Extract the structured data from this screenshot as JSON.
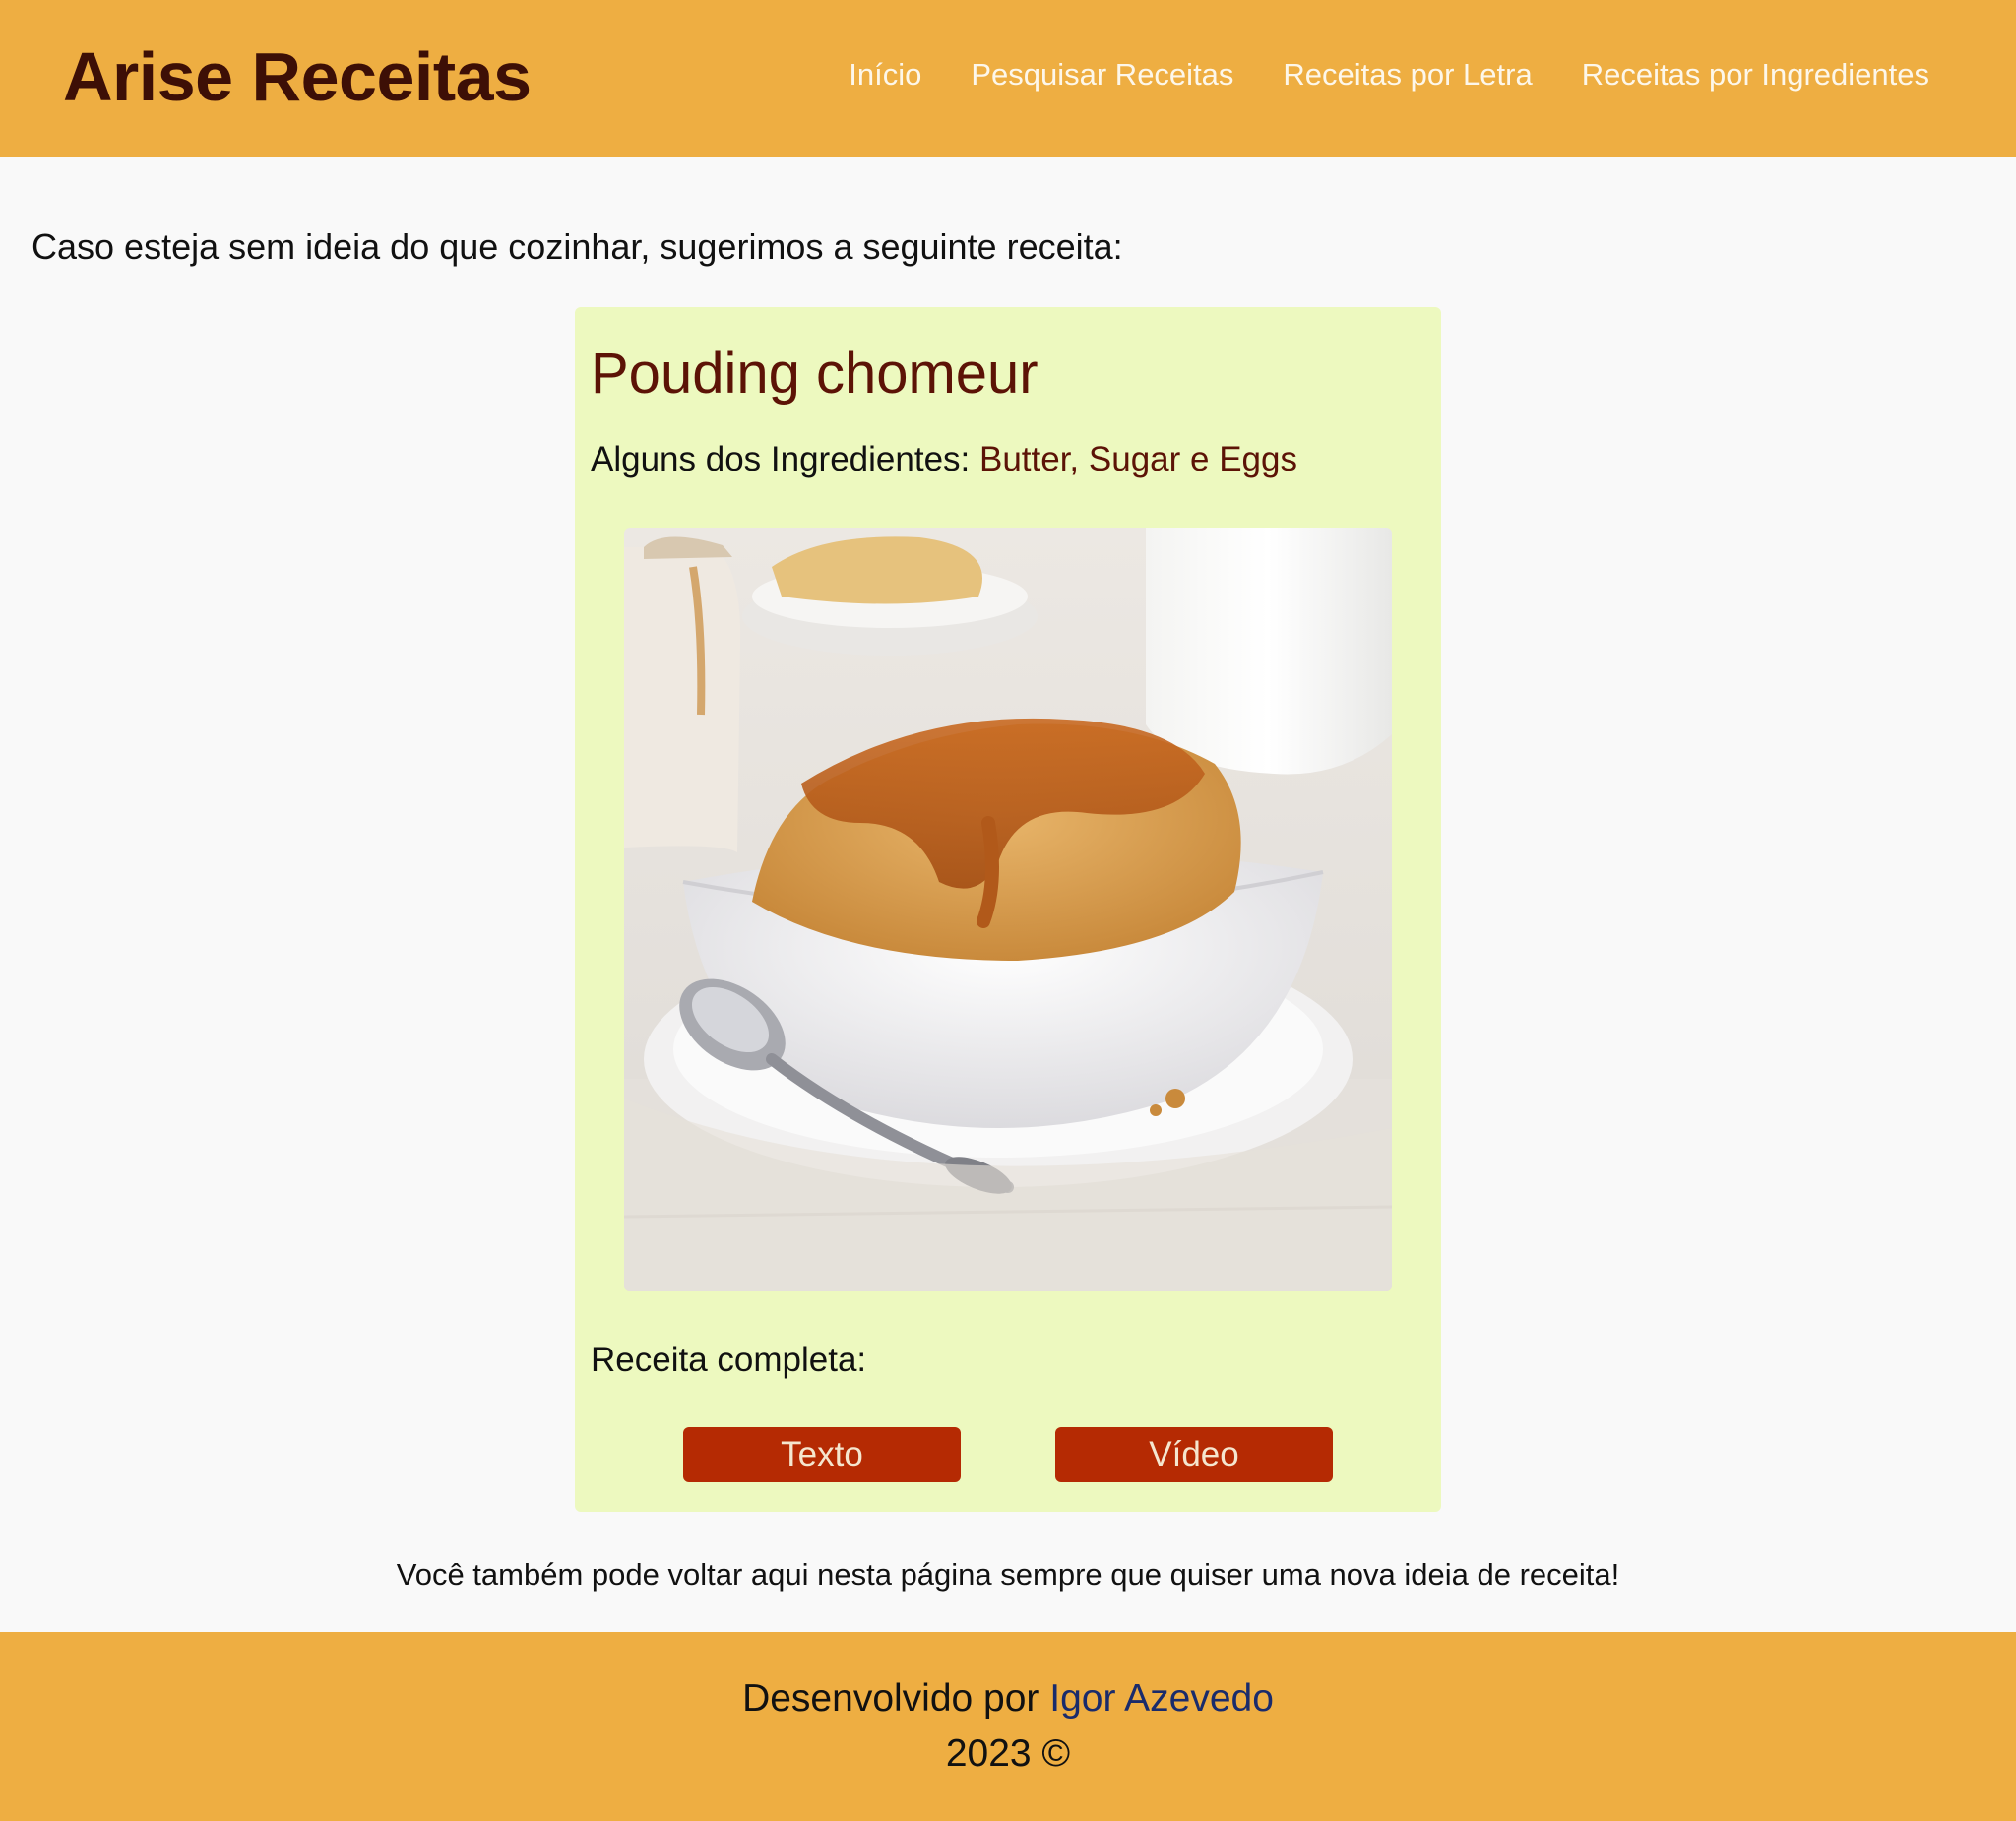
{
  "header": {
    "brand": "Arise Receitas",
    "nav": [
      {
        "label": "Início"
      },
      {
        "label": "Pesquisar Receitas"
      },
      {
        "label": "Receitas por Letra"
      },
      {
        "label": "Receitas por Ingredientes"
      }
    ]
  },
  "intro": "Caso esteja sem ideia do que cozinhar, sugerimos a seguinte receita:",
  "recipe": {
    "title": "Pouding chomeur",
    "ingredients_label": "Alguns dos Ingredientes: ",
    "ingredients": "Butter, Sugar e Eggs",
    "full_recipe_label": "Receita completa:",
    "buttons": {
      "text": "Texto",
      "video": "Vídeo"
    }
  },
  "note": "Você também pode voltar aqui nesta página sempre que quiser uma nova ideia de receita!",
  "footer": {
    "developed_by": "Desenvolvido por ",
    "author": "Igor Azevedo",
    "copyright": "2023 ©"
  },
  "colors": {
    "header_bg": "#eeae42",
    "brand": "#3d0f06",
    "card_bg": "#edf9bf",
    "title": "#5c1306",
    "button_bg": "#b52a03",
    "link": "#1a2b6b"
  }
}
